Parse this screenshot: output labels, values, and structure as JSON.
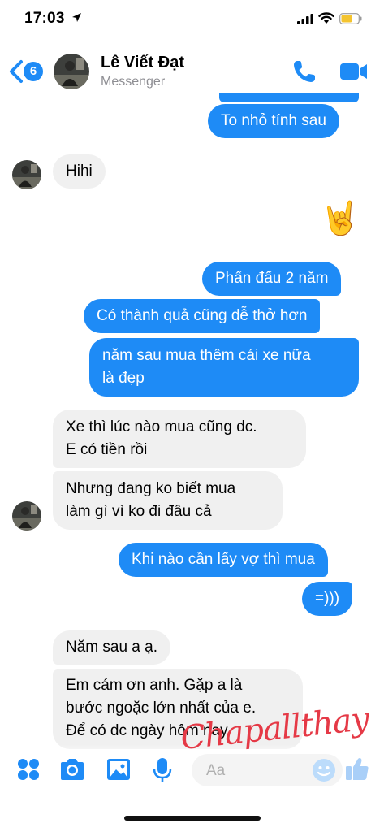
{
  "status_bar": {
    "time": "17:03"
  },
  "header": {
    "unread_count": "6",
    "contact_name": "Lê Viết Đạt",
    "platform": "Messenger"
  },
  "messages": [
    {
      "from": "me",
      "text": "To nhỏ tính sau"
    },
    {
      "from": "them",
      "text": "Hihi"
    },
    {
      "from": "me",
      "type": "emoji",
      "icon": "sign-of-the-horns-emoji"
    },
    {
      "from": "me",
      "text": "Phấn đấu 2 năm"
    },
    {
      "from": "me",
      "text": "Có thành quả cũng dễ thở hơn"
    },
    {
      "from": "me",
      "lines": [
        "năm sau mua thêm cái xe nữa",
        "là đẹp"
      ]
    },
    {
      "from": "them",
      "lines": [
        "Xe thì lúc nào mua cũng dc.",
        "E có tiền rồi"
      ]
    },
    {
      "from": "them",
      "lines": [
        "Nhưng đang ko biết mua",
        "làm gì vì ko đi đâu cả"
      ]
    },
    {
      "from": "me",
      "text": "Khi nào cần lấy vợ thì mua"
    },
    {
      "from": "me",
      "text": "=)))"
    },
    {
      "from": "them",
      "text": "Năm sau a ạ."
    },
    {
      "from": "them",
      "lines": [
        "Em cám ơn anh. Gặp a là",
        "bước ngoặc lớn nhất của e.",
        "Để có dc ngày hôm nay."
      ]
    }
  ],
  "composer": {
    "placeholder": "Aa",
    "icons": [
      "apps-icon",
      "camera-icon",
      "photo-icon",
      "microphone-icon",
      "emoji-icon",
      "like-icon"
    ]
  },
  "watermark": "Chapallthay",
  "colors": {
    "accent": "#1e8bf6",
    "incoming_bubble": "#f0f0f0",
    "watermark": "#e53946"
  }
}
